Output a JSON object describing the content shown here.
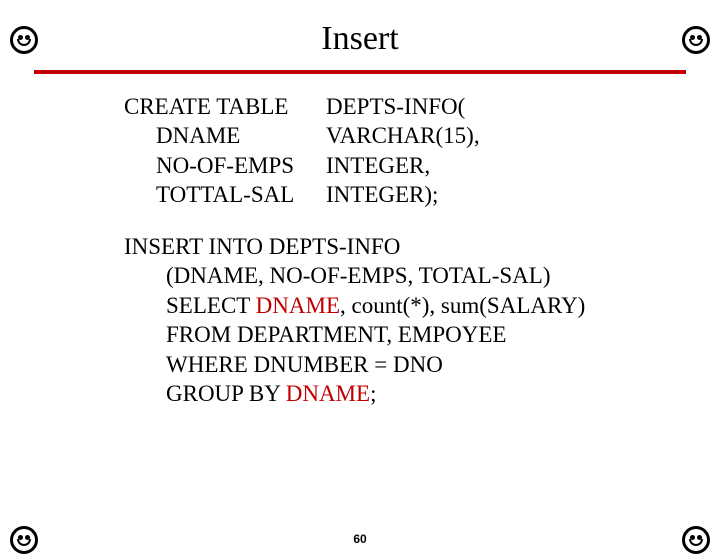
{
  "corner_icon": "smiley-face",
  "title": "Insert",
  "create": {
    "line0_a": "CREATE TABLE",
    "line0_b": "DEPTS-INFO(",
    "rows": [
      {
        "name": "DNAME",
        "type": "VARCHAR(15),"
      },
      {
        "name": " NO-OF-EMPS",
        "type": "INTEGER,"
      },
      {
        "name": "TOTTAL-SAL",
        "type": "INTEGER);"
      }
    ]
  },
  "insert": {
    "line0": "INSERT INTO DEPTS-INFO",
    "line1": "(DNAME, NO-OF-EMPS, TOTAL-SAL)",
    "line2_a": "SELECT ",
    "line2_b": "DNAME",
    "line2_c": ", count(*), sum(SALARY)",
    "line3": "FROM DEPARTMENT, EMPOYEE",
    "line4": "WHERE DNUMBER = DNO",
    "line5_a": "GROUP BY ",
    "line5_b": "DNAME",
    "line5_c": ";"
  },
  "page_number": "60"
}
